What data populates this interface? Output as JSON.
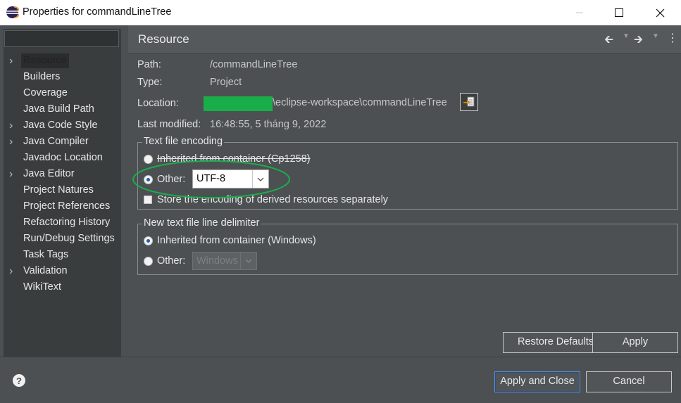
{
  "window": {
    "title": "Properties for commandLineTree"
  },
  "sidebar": {
    "filter_value": "",
    "items": [
      {
        "label": "Resource",
        "expandable": true
      },
      {
        "label": "Builders",
        "expandable": false
      },
      {
        "label": "Coverage",
        "expandable": false
      },
      {
        "label": "Java Build Path",
        "expandable": false
      },
      {
        "label": "Java Code Style",
        "expandable": true
      },
      {
        "label": "Java Compiler",
        "expandable": true
      },
      {
        "label": "Javadoc Location",
        "expandable": false
      },
      {
        "label": "Java Editor",
        "expandable": true
      },
      {
        "label": "Project Natures",
        "expandable": false
      },
      {
        "label": "Project References",
        "expandable": false
      },
      {
        "label": "Refactoring History",
        "expandable": false
      },
      {
        "label": "Run/Debug Settings",
        "expandable": false
      },
      {
        "label": "Task Tags",
        "expandable": false
      },
      {
        "label": "Validation",
        "expandable": true
      },
      {
        "label": "WikiText",
        "expandable": false
      }
    ],
    "selected": "Resource"
  },
  "page": {
    "title": "Resource",
    "path_label": "Path:",
    "path_value": "/commandLineTree",
    "type_label": "Type:",
    "type_value": "Project",
    "location_label": "Location:",
    "location_value": "\\eclipse-workspace\\commandLineTree",
    "modified_label": "Last modified:",
    "modified_value": "16:48:55, 5 tháng 9, 2022"
  },
  "encoding": {
    "legend": "Text file encoding",
    "inherited_label": "Inherited from container (Cp1258)",
    "other_label": "Other:",
    "other_value": "UTF-8",
    "store_label": "Store the encoding of derived resources separately",
    "selected": "other",
    "store_checked": false
  },
  "delimiter": {
    "legend": "New text file line delimiter",
    "inherited_label": "Inherited from container (Windows)",
    "other_label": "Other:",
    "other_value": "Windows",
    "selected": "inherited"
  },
  "buttons": {
    "restore_defaults": "Restore Defaults",
    "apply": "Apply",
    "apply_and_close": "Apply and Close",
    "cancel": "Cancel"
  },
  "colors": {
    "dialog_bg": "#4c5052",
    "sidebar_bg": "#3a3d3e",
    "annotation_ellipse": "#1aae4b",
    "redaction_block": "#1aae4b",
    "radio_dot": "#1a5fb4"
  }
}
